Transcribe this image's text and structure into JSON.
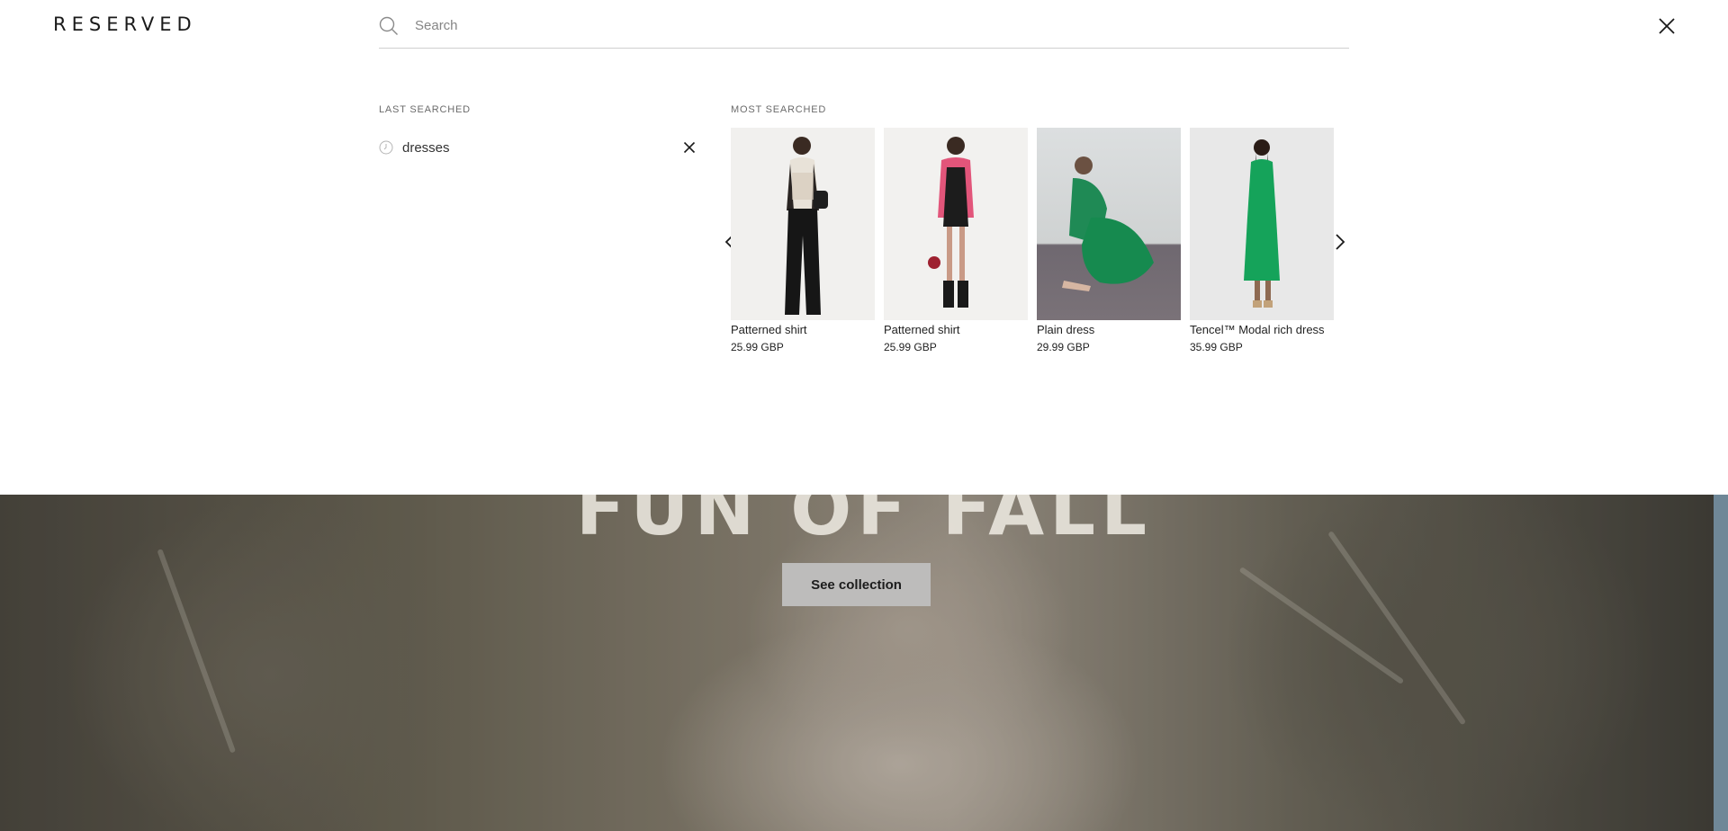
{
  "header": {
    "logo": "RESERVED",
    "search_placeholder": "Search",
    "search_value": ""
  },
  "recent": {
    "label": "LAST SEARCHED",
    "items": [
      {
        "text": "dresses"
      }
    ]
  },
  "popular": {
    "label": "MOST SEARCHED",
    "products": [
      {
        "name": "Patterned shirt",
        "price": "25.99 GBP"
      },
      {
        "name": "Patterned shirt",
        "price": "25.99 GBP"
      },
      {
        "name": "Plain dress",
        "price": "29.99 GBP"
      },
      {
        "name": "Tencel™ Modal rich dress",
        "price": "35.99 GBP"
      }
    ]
  },
  "hero": {
    "title": "FUN OF FALL",
    "button": "See collection"
  },
  "colors": {
    "accent": "#1a1a1a",
    "hero_button_bg": "#bdbcbb"
  }
}
